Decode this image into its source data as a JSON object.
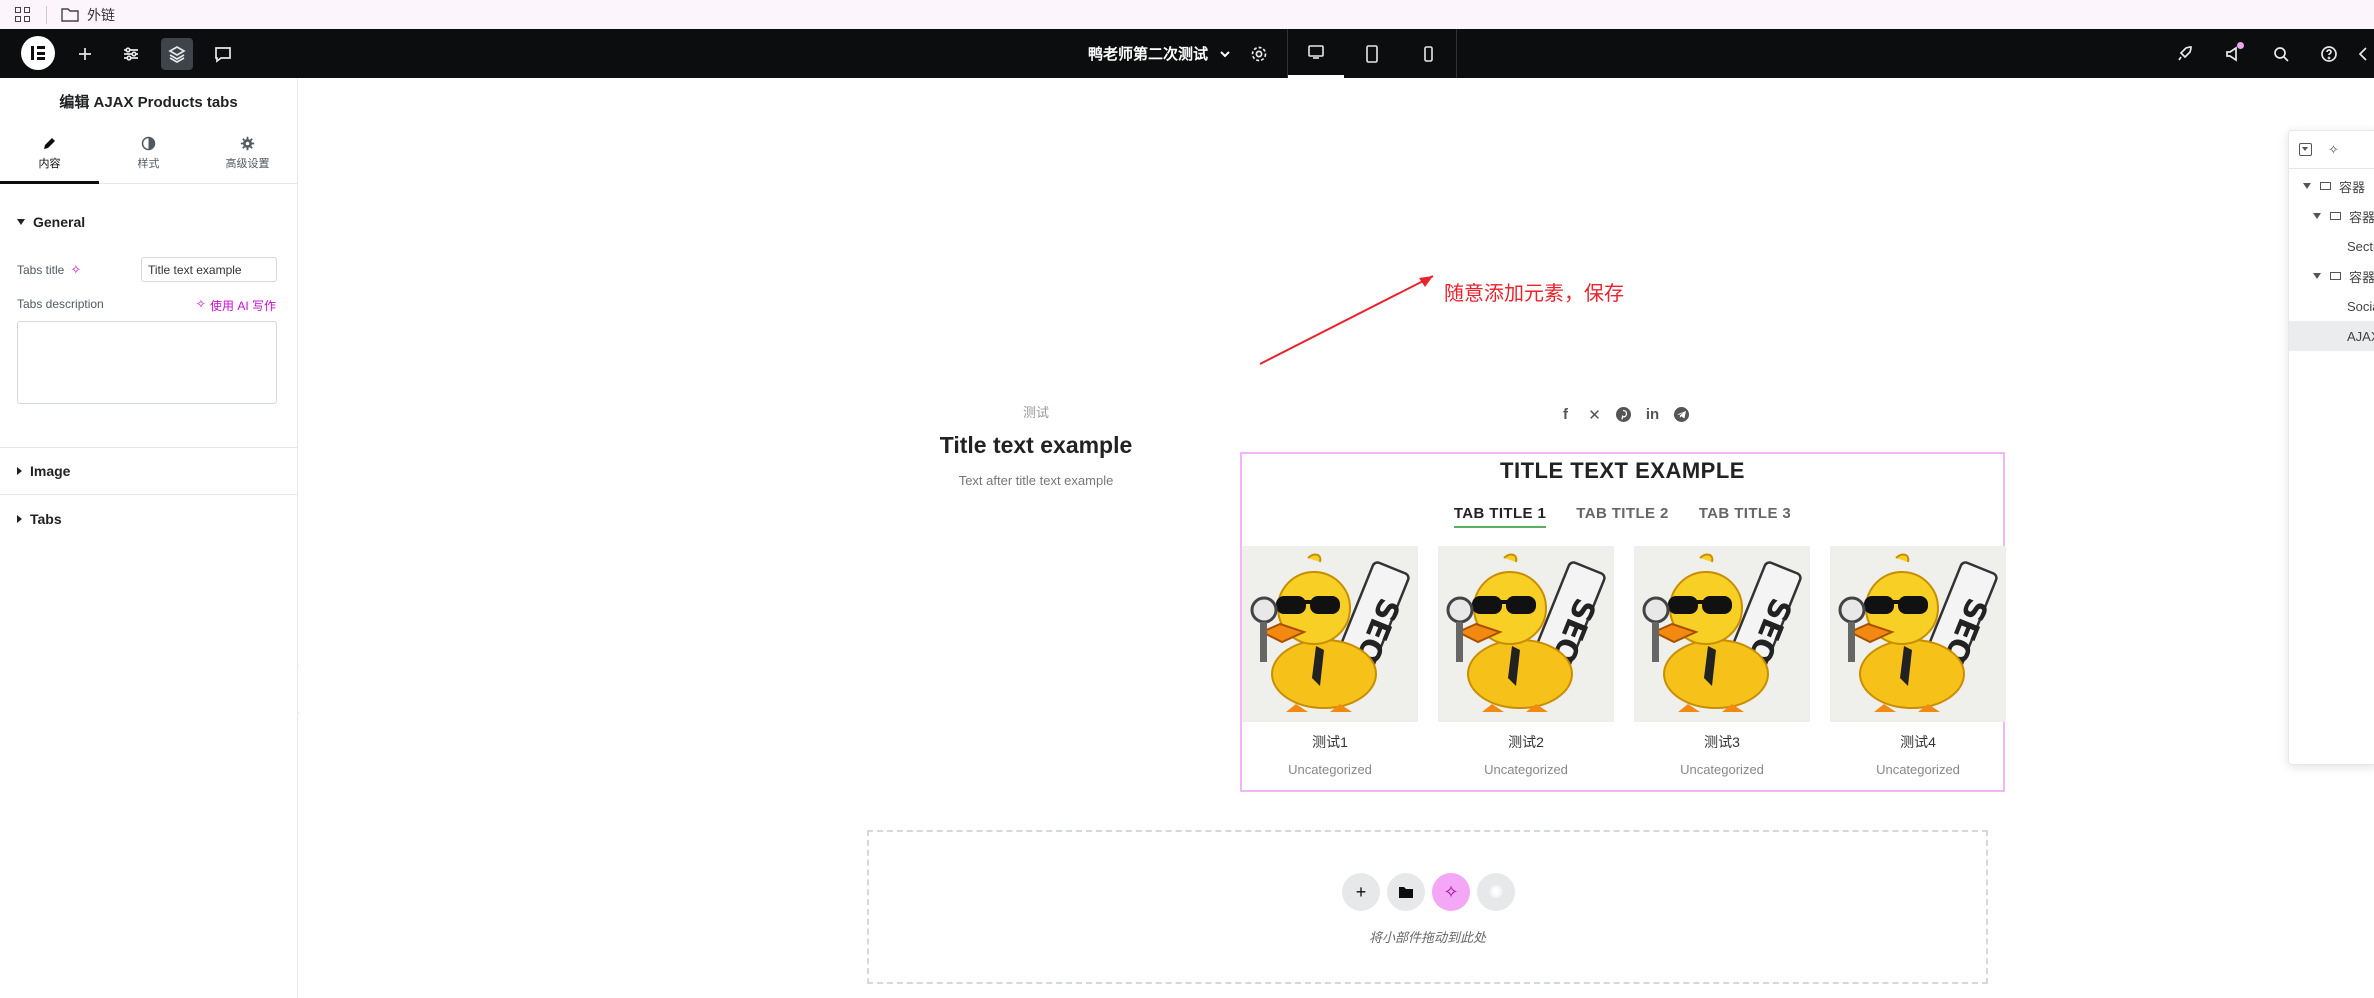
{
  "bookmark_bar": {
    "folder_label": "外链"
  },
  "topbar": {
    "document_title": "鸭老师第二次测试"
  },
  "panel": {
    "title": "编辑 AJAX Products tabs",
    "tabs": [
      {
        "label": "内容"
      },
      {
        "label": "样式"
      },
      {
        "label": "高级设置"
      }
    ],
    "general_section": "General",
    "tabs_title_label": "Tabs title",
    "tabs_title_value": "Title text example",
    "tabs_description_label": "Tabs description",
    "ai_write_label": "使用 AI 写作",
    "image_section": "Image",
    "tabs_section": "Tabs"
  },
  "annotation": {
    "text": "随意添加元素，保存",
    "color": "#e8232d"
  },
  "left_widget": {
    "subtitle": "测试",
    "title": "Title text example",
    "description": "Text after title text example"
  },
  "social_icons": [
    "facebook-icon",
    "x-icon",
    "pinterest-icon",
    "linkedin-icon",
    "telegram-icon"
  ],
  "products_widget": {
    "title": "TITLE TEXT EXAMPLE",
    "tabs": [
      {
        "label": "TAB TITLE 1",
        "active": true
      },
      {
        "label": "TAB TITLE 2",
        "active": false
      },
      {
        "label": "TAB TITLE 3",
        "active": false
      }
    ],
    "products": [
      {
        "name": "测试1",
        "category": "Uncategorized"
      },
      {
        "name": "测试2",
        "category": "Uncategorized"
      },
      {
        "name": "测试3",
        "category": "Uncategorized"
      },
      {
        "name": "测试4",
        "category": "Uncategorized"
      }
    ],
    "accent_color": "#5bb05b",
    "border_color": "#f2b6f5"
  },
  "drop_zone": {
    "text": "将小部件拖动到此处"
  },
  "navigator": {
    "rows": [
      {
        "label": "容器"
      },
      {
        "label": "容器"
      },
      {
        "label": "Secti"
      },
      {
        "label": "容器"
      },
      {
        "label": "Socia"
      },
      {
        "label": "AJAX"
      }
    ]
  }
}
